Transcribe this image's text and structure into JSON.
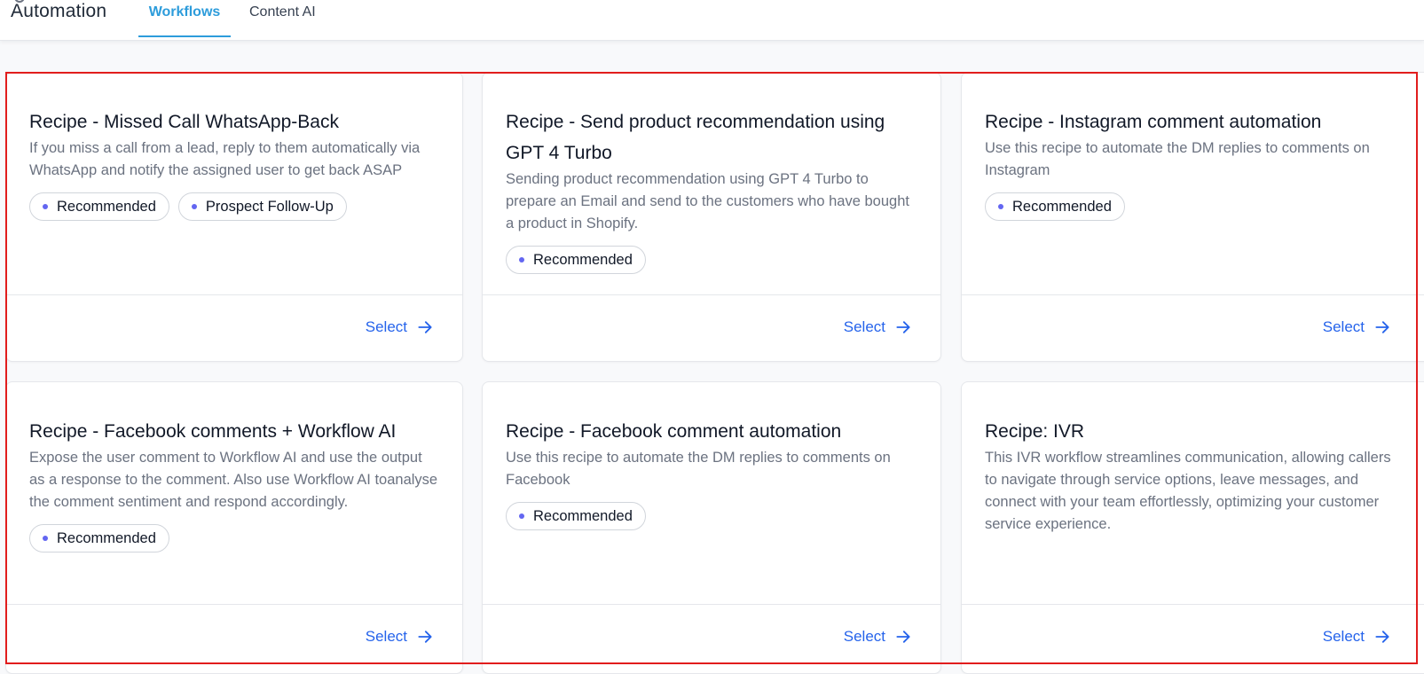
{
  "header": {
    "app_title": "Automation",
    "tabs": [
      {
        "label": "Workflows",
        "active": true
      },
      {
        "label": "Content AI",
        "active": false
      }
    ]
  },
  "colors": {
    "accent": "#2d9cdb",
    "link": "#2563eb",
    "tag_dot": "#6366f1",
    "highlight": "#e11d1d"
  },
  "cards": [
    {
      "title": "Recipe - Missed Call WhatsApp-Back",
      "description": "If you miss a call from a lead, reply to them automatically via WhatsApp and notify the assigned user to get back ASAP",
      "tags": [
        "Recommended",
        "Prospect Follow-Up"
      ],
      "action": "Select"
    },
    {
      "title": "Recipe - Send product recommendation using GPT 4 Turbo",
      "description": "Sending product recommendation using GPT 4 Turbo to prepare an Email and send to the customers who have bought a product in Shopify.",
      "tags": [
        "Recommended"
      ],
      "action": "Select"
    },
    {
      "title": "Recipe - Instagram comment automation",
      "description": "Use this recipe to automate the DM replies to comments on Instagram",
      "tags": [
        "Recommended"
      ],
      "action": "Select"
    },
    {
      "title": "Recipe - Facebook comments + Workflow AI",
      "description": "Expose the user comment to Workflow AI and use the output as a response to the comment. Also use Workflow AI toanalyse the comment sentiment and respond accordingly.",
      "tags": [
        "Recommended"
      ],
      "action": "Select"
    },
    {
      "title": "Recipe - Facebook comment automation",
      "description": "Use this recipe to automate the DM replies to comments on Facebook",
      "tags": [
        "Recommended"
      ],
      "action": "Select"
    },
    {
      "title": "Recipe: IVR",
      "description": "This IVR workflow streamlines communication, allowing callers to navigate through service options, leave messages, and connect with your team effortlessly, optimizing your customer service experience.",
      "tags": [],
      "action": "Select"
    }
  ]
}
